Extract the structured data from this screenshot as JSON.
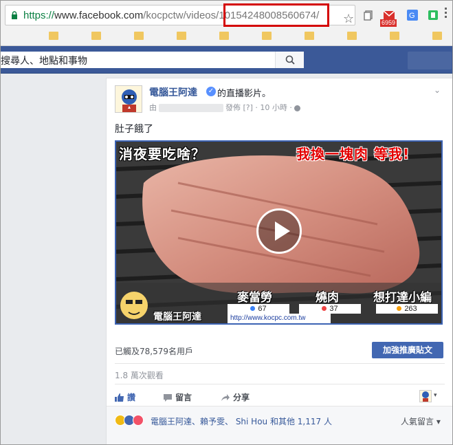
{
  "browser": {
    "url": {
      "scheme": "https://",
      "host": "www.facebook.com",
      "path": "/kocpctw/videos/",
      "video_id": "10154248008560674",
      "trailing": "/"
    },
    "extensions": {
      "mail_badge": "6959"
    }
  },
  "fb_header": {
    "search_placeholder": "搜尋人、地點和事物"
  },
  "post": {
    "author": "電腦王阿達",
    "action_text": "的直播影片。",
    "meta": {
      "by": "由",
      "posted": "發佈",
      "q": "[?]",
      "dot": "·",
      "time": "10 小時"
    },
    "text": "肚子餓了",
    "video": {
      "caption_left": "消夜要吃啥？",
      "caption_right": "我換一塊肉 等我!",
      "options": [
        {
          "label": "麥當勞",
          "votes": "67",
          "color": "#3b82f6"
        },
        {
          "label": "燒肉",
          "votes": "37",
          "color": "#ef4444"
        },
        {
          "label": "想打達小編",
          "votes": "263",
          "color": "#f59e0b"
        }
      ],
      "brand": "電腦王阿達",
      "site": "http://www.kocpc.com.tw"
    },
    "reached": "已觸及78,579名用戶",
    "boost_button": "加強推廣貼文",
    "views": "1.8 萬次觀看",
    "actions": {
      "like": "讚",
      "comment": "留言",
      "share": "分享"
    },
    "reactions": {
      "likers_text": "電腦王阿達、賴予雯、 Shi Hou 和其他 1,117 人",
      "sort_label": "人氣留言"
    }
  }
}
